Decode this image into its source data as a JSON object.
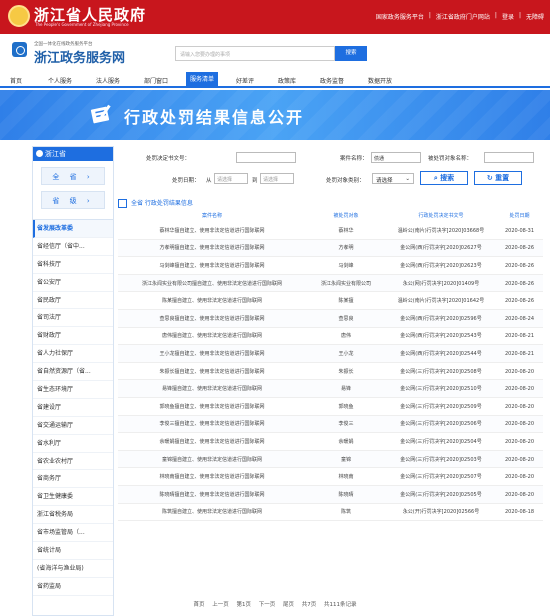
{
  "topbar": {
    "title": "浙江省人民政府",
    "subtitle": "The People's Government of Zhejiang Province",
    "links": [
      "国家政务服务平台",
      "|",
      "浙江省政府门户网站",
      "|",
      "登录",
      "|",
      "无障碍"
    ]
  },
  "header": {
    "small": "全国一体化在线政务服务平台",
    "title": "浙江政务服务网",
    "search_placeholder": "请输入您要办理的事项",
    "search_label": "搜索"
  },
  "nav": [
    "首页",
    "个人服务",
    "法人服务",
    "部门窗口",
    "服务清单",
    "好差评",
    "政策库",
    "政务监督",
    "数据开放"
  ],
  "nav_active": 4,
  "banner": {
    "title": "行政处罚结果信息公开"
  },
  "sidebar": {
    "region": "浙江省",
    "all_label": "全 省",
    "level_label": "省 级",
    "items": [
      "省发展改革委",
      "省经信厅（省中...",
      "省科技厅",
      "省公安厅",
      "省民政厅",
      "省司法厅",
      "省财政厅",
      "省人力社保厅",
      "省自然资源厅（省...",
      "省生态环境厅",
      "省建设厅",
      "省交通运输厅",
      "省水利厅",
      "省农业农村厅",
      "省商务厅",
      "省卫生健康委",
      "浙江省税务局",
      "省市场监管局（...",
      "省统计局",
      "(省海洋与渔业局)",
      "省药监局"
    ],
    "active_index": 0
  },
  "form": {
    "doc_no_label": "处罚决定书文号：",
    "case_name_label": "案件名称：",
    "case_name_value": "债通",
    "target_label": "被处罚对象名称：",
    "date_label": "处罚日期：",
    "from_label": "从",
    "to_label": "到",
    "date_placeholder": "请选择",
    "target_type_label": "处罚对象类别：",
    "target_type_value": "请选择",
    "search_label": "搜索",
    "reset_label": "重置"
  },
  "results": {
    "title": "全省 行政处罚结果信息",
    "headers": [
      "案件名称",
      "被处罚对象",
      "行政处罚决定书文号",
      "处罚日期"
    ],
    "rows": [
      [
        "蔡林华擅自建立、使用非法定信道进行国际联网",
        "蔡林华",
        "温岭公(南片)行罚决字[2020]03668号",
        "2020-08-31"
      ],
      [
        "方孝明擅自建立、使用非法定信道进行国际联网",
        "方孝明",
        "金公网(西)行罚决字[2020]02627号",
        "2020-08-26"
      ],
      [
        "马剑峰擅自建立、使用非法定信道进行国际联网",
        "马剑峰",
        "金公网(西)行罚决字[2020]02623号",
        "2020-08-26"
      ],
      [
        "浙江永闻实业有限公司擅自建立、使用非法定信道进行国际联网",
        "浙江永闻实业有限公司",
        "永公(网)行罚决字[2020]01409号",
        "2020-08-26"
      ],
      [
        "陈某擅自建立、使用非法定信道进行国际联网",
        "陈某擅",
        "温岭公(南片)行罚决字[2020]01642号",
        "2020-08-26"
      ],
      [
        "查思良擅自建立、使用非法定信道进行国际联网",
        "查思良",
        "金公网(西)行罚决字[2020]02596号",
        "2020-08-24"
      ],
      [
        "唐伟擅自建立、使用非法定信道进行国际联网",
        "唐伟",
        "金公网(西)行罚决字[2020]02543号",
        "2020-08-21"
      ],
      [
        "王小龙擅自建立、使用非法定信道进行国际联网",
        "王小龙",
        "金公网(西)行罚决字[2020]02544号",
        "2020-08-21"
      ],
      [
        "朱振长擅自建立、使用非法定信道进行国际联网",
        "朱振长",
        "金公网(三)行罚决字[2020]02508号",
        "2020-08-20"
      ],
      [
        "易锋擅自建立、使用非法定信道进行国际联网",
        "易锋",
        "金公网(三)行罚决字[2020]02510号",
        "2020-08-20"
      ],
      [
        "郭晓鱼擅自建立、使用非法定信道进行国际联网",
        "郭晓鱼",
        "金公网(三)行罚决字[2020]02509号",
        "2020-08-20"
      ],
      [
        "李俊三擅自建立、使用非法定信道进行国际联网",
        "李俊三",
        "金公网(三)行罚决字[2020]02506号",
        "2020-08-20"
      ],
      [
        "余暖娟擅自建立、使用非法定信道进行国际联网",
        "余暖娟",
        "金公网(三)行罚决字[2020]02504号",
        "2020-08-20"
      ],
      [
        "童锦擅自建立、使用非法定信道进行国际联网",
        "童锦",
        "金公网(三)行罚决字[2020]02503号",
        "2020-08-20"
      ],
      [
        "林晓南擅自建立、使用非法定信道进行国际联网",
        "林晓南",
        "金公网(三)行罚决字[2020]02507号",
        "2020-08-20"
      ],
      [
        "陈晓晴擅自建立、使用非法定信道进行国际联网",
        "陈晓晴",
        "金公网(三)行罚决字[2020]02505号",
        "2020-08-20"
      ],
      [
        "陈筑擅自建立、使用非法定信道进行国际联网",
        "陈筑",
        "永公(开)行罚决字[2020]02566号",
        "2020-08-18"
      ]
    ]
  },
  "pager": [
    "首页",
    "上一页",
    "第1页",
    "下一页",
    "尾页",
    "共7页",
    "共111条记录"
  ],
  "colors": {
    "topbar": "#c8161d",
    "accent": "#1e6ee0"
  }
}
